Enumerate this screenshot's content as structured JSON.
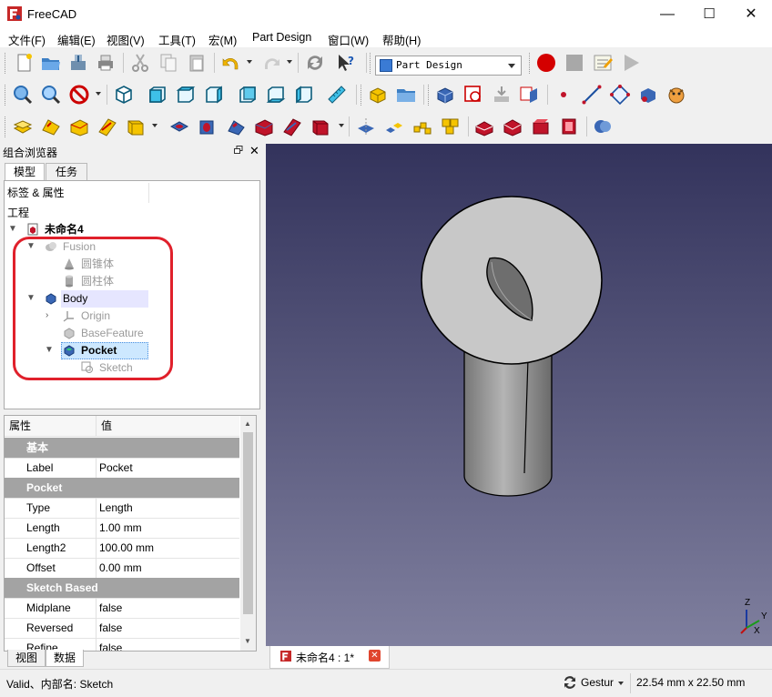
{
  "window": {
    "title": "FreeCAD",
    "min": "—",
    "max": "☐",
    "close": "✕"
  },
  "menu": [
    "文件(F)",
    "编辑(E)",
    "视图(V)",
    "工具(T)",
    "宏(M)",
    "Part Design",
    "窗口(W)",
    "帮助(H)"
  ],
  "workbench": {
    "selected": "Part Design"
  },
  "combo": {
    "title": "组合浏览器",
    "tabs": {
      "model": "模型",
      "task": "任务"
    },
    "tree_header": "标签 & 属性",
    "section": "工程",
    "tree": {
      "doc": "未命名4",
      "fusion": "Fusion",
      "cone": "圆锥体",
      "cylinder": "圆柱体",
      "body": "Body",
      "origin": "Origin",
      "base": "BaseFeature",
      "pocket": "Pocket",
      "sketch": "Sketch"
    },
    "props": {
      "col_prop": "属性",
      "col_val": "值",
      "rows": [
        {
          "group": "基本"
        },
        {
          "name": "Label",
          "value": "Pocket"
        },
        {
          "group": "Pocket"
        },
        {
          "name": "Type",
          "value": "Length"
        },
        {
          "name": "Length",
          "value": "1.00 mm"
        },
        {
          "name": "Length2",
          "value": "100.00 mm"
        },
        {
          "name": "Offset",
          "value": "0.00 mm"
        },
        {
          "group": "Sketch Based"
        },
        {
          "name": "Midplane",
          "value": "false"
        },
        {
          "name": "Reversed",
          "value": "false"
        },
        {
          "name": "Refine",
          "value": "false"
        }
      ]
    },
    "bottom_tabs": {
      "view": "视图",
      "data": "数据"
    }
  },
  "doc_tab": {
    "label": "未命名4 : 1*"
  },
  "axes": {
    "z": "Z",
    "y": "Y",
    "x": "X"
  },
  "status": {
    "message": "Valid、内部名: Sketch",
    "nav_style": "Gestur",
    "dimensions": "22.54 mm x 22.50 mm"
  },
  "colors": {
    "accent_red": "#e0202b",
    "view_top": "#33335c",
    "view_bottom": "#7f7f9e",
    "selection": "#cde8ff"
  }
}
